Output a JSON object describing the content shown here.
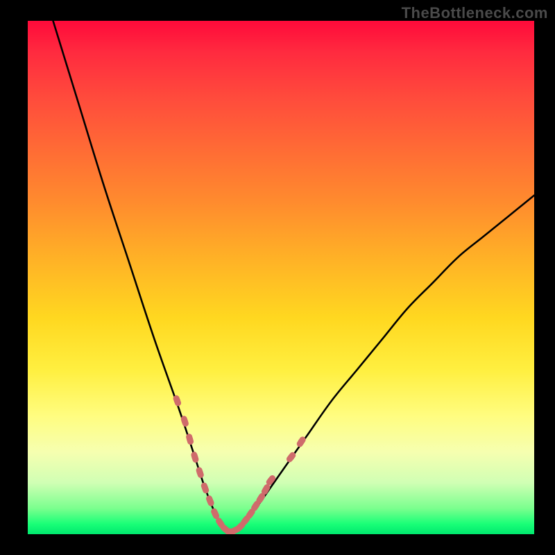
{
  "watermark": "TheBottleneck.com",
  "colors": {
    "frame": "#000000",
    "curve": "#000000",
    "markers": "#cf6b6b",
    "gradient_top": "#ff0a3a",
    "gradient_mid": "#ffef40",
    "gradient_bottom": "#00e86e"
  },
  "chart_data": {
    "type": "line",
    "title": "",
    "xlabel": "",
    "ylabel": "",
    "xlim": [
      0,
      100
    ],
    "ylim": [
      0,
      100
    ],
    "grid": false,
    "legend": false,
    "series": [
      {
        "name": "bottleneck-curve",
        "x": [
          5,
          10,
          15,
          20,
          25,
          30,
          33,
          35,
          37,
          38.5,
          40,
          42,
          45,
          50,
          55,
          60,
          65,
          70,
          75,
          80,
          85,
          90,
          95,
          100
        ],
        "y": [
          100,
          84,
          68,
          53,
          38,
          24,
          15,
          9,
          4,
          1,
          0.5,
          1.5,
          5,
          12,
          19,
          26,
          32,
          38,
          44,
          49,
          54,
          58,
          62,
          66
        ]
      }
    ],
    "markers": {
      "name": "highlight-dots",
      "x": [
        29.5,
        31,
        32,
        33,
        34,
        35,
        36,
        37,
        38,
        39,
        40,
        41,
        42,
        43,
        44,
        45,
        46,
        47,
        48,
        52,
        54
      ],
      "y": [
        26,
        22,
        18.5,
        15,
        12,
        9,
        6.5,
        4,
        2.2,
        1,
        0.5,
        0.8,
        1.5,
        2.7,
        4,
        5.5,
        7,
        8.7,
        10.5,
        15,
        18
      ]
    },
    "minimum_at_x": 40
  }
}
